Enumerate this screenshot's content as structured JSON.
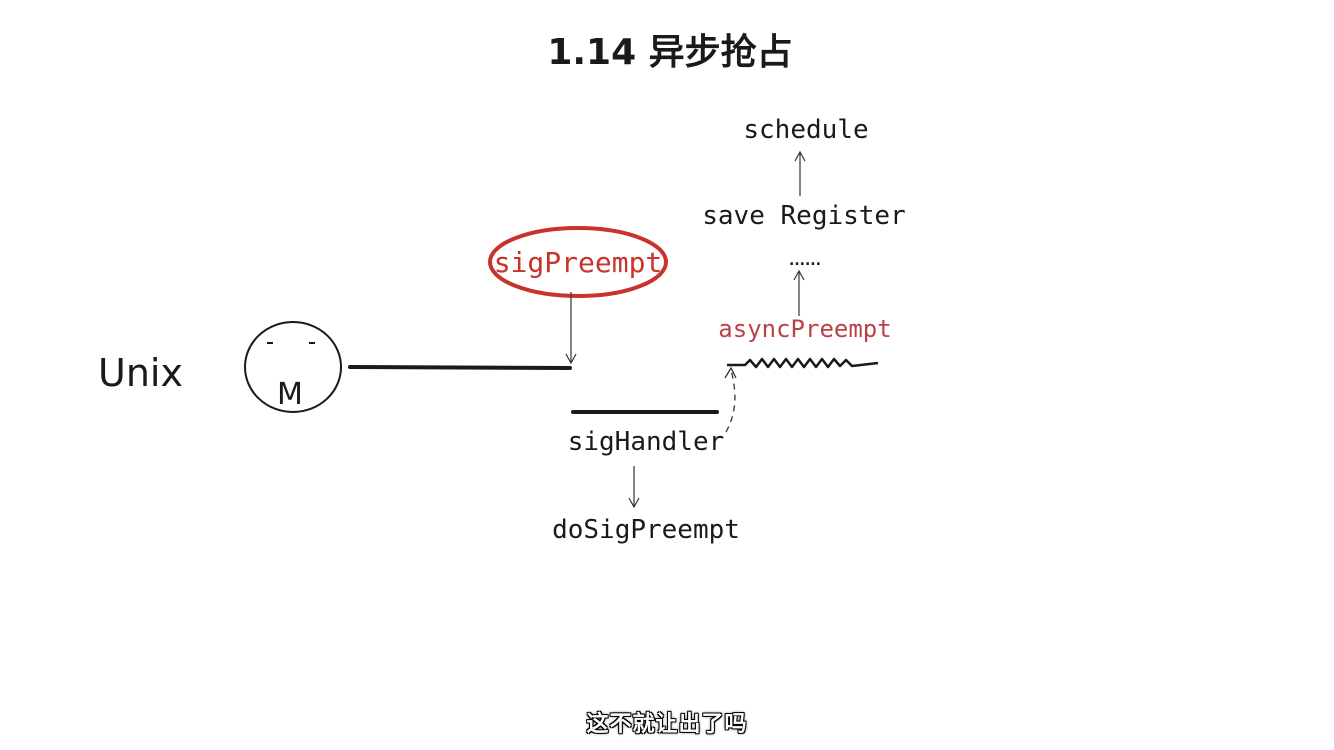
{
  "title": "1.14 异步抢占",
  "labels": {
    "unix": "Unix",
    "m_node": "M",
    "sig_preempt": "sigPreempt",
    "sig_handler": "sigHandler",
    "do_sig_preempt": "doSigPreempt",
    "async_preempt": "asyncPreempt",
    "ellipsis": "......",
    "save_register": "save Register",
    "schedule": "schedule"
  },
  "subtitle": "这不就让出了吗",
  "colors": {
    "ink": "#1a1a1a",
    "highlight": "#c8332b",
    "async_text": "#b9424a",
    "subtitle_text": "#ffffff"
  }
}
